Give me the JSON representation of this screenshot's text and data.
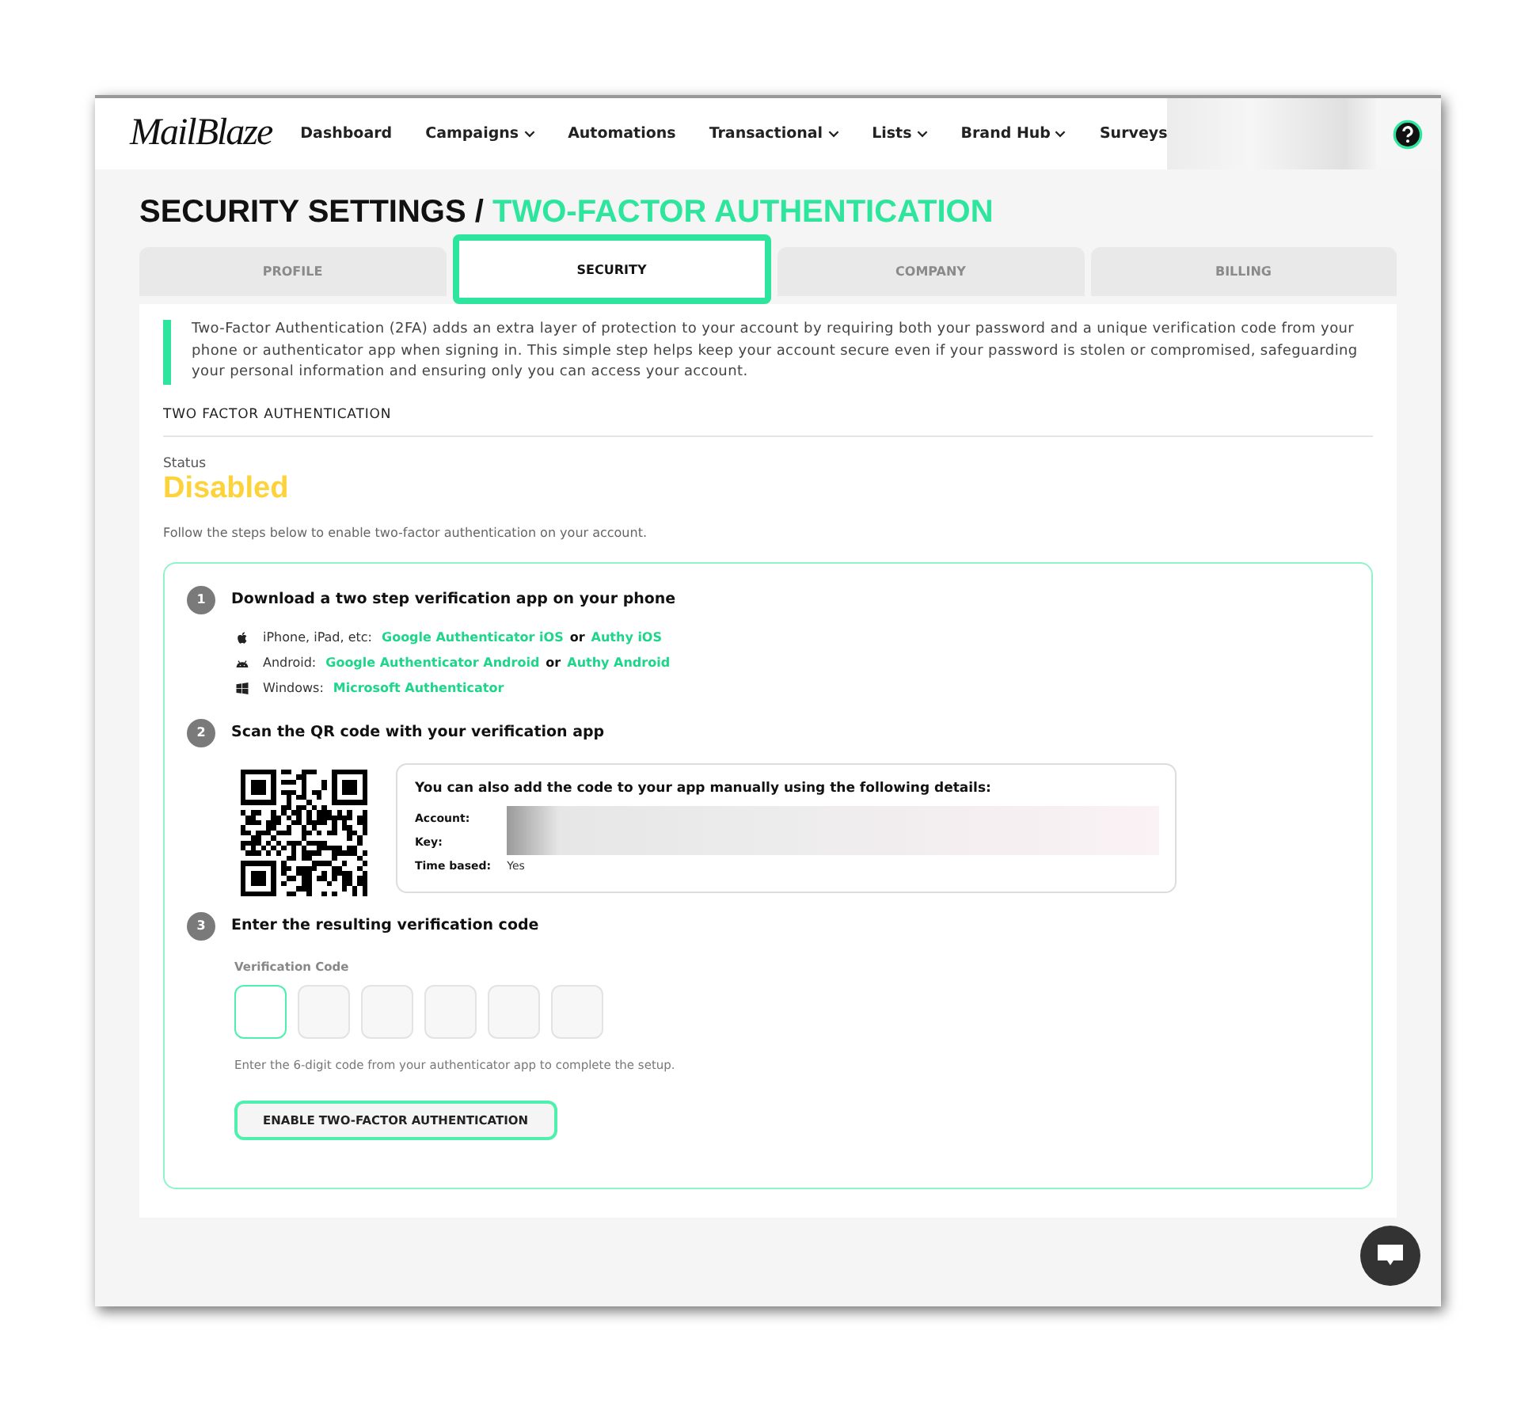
{
  "nav": {
    "logo": "MailBlaze",
    "items": [
      {
        "label": "Dashboard",
        "has_menu": false
      },
      {
        "label": "Campaigns",
        "has_menu": true
      },
      {
        "label": "Automations",
        "has_menu": false
      },
      {
        "label": "Transactional",
        "has_menu": true
      },
      {
        "label": "Lists",
        "has_menu": true
      },
      {
        "label": "Brand Hub",
        "has_menu": true
      },
      {
        "label": "Surveys",
        "has_menu": false
      }
    ]
  },
  "title": {
    "main": "SECURITY SETTINGS /",
    "accent": "TWO-FACTOR AUTHENTICATION"
  },
  "tabs": [
    {
      "label": "PROFILE",
      "selected": false
    },
    {
      "label": "SECURITY",
      "selected": true
    },
    {
      "label": "COMPANY",
      "selected": false
    },
    {
      "label": "BILLING",
      "selected": false
    }
  ],
  "intro": "Two-Factor Authentication (2FA) adds an extra layer of protection to your account by requiring both your password and a unique verification code from your phone or authenticator app when signing in. This simple step helps keep your account secure even if your password is stolen or compromised, safeguarding your personal information and ensuring only you can access your account.",
  "section_heading": "TWO FACTOR AUTHENTICATION",
  "status": {
    "label": "Status",
    "value": "Disabled"
  },
  "hint": "Follow the steps below to enable two-factor authentication on your account.",
  "steps": [
    {
      "number": "1",
      "title": "Download a two step verification app on your phone",
      "kind": "apps",
      "platforms": [
        {
          "kind": "apple",
          "label": "iPhone, iPad, etc:",
          "parts": [
            {
              "kind": "link",
              "text": "Google Authenticator iOS"
            },
            {
              "kind": "plain",
              "text": "or"
            },
            {
              "kind": "link",
              "text": "Authy iOS"
            }
          ]
        },
        {
          "kind": "android",
          "label": "Android:",
          "parts": [
            {
              "kind": "link",
              "text": "Google Authenticator Android"
            },
            {
              "kind": "plain",
              "text": "or"
            },
            {
              "kind": "link",
              "text": "Authy Android"
            }
          ]
        },
        {
          "kind": "windows",
          "label": "Windows:",
          "parts": [
            {
              "kind": "link",
              "text": "Microsoft Authenticator"
            }
          ]
        }
      ]
    },
    {
      "number": "2",
      "title": "Scan the QR code with your verification app",
      "kind": "qr",
      "manual": {
        "heading": "You can also add the code to your app manually using the following details:",
        "rows": [
          {
            "label": "Account:"
          },
          {
            "label": "Key:"
          },
          {
            "label": "Time based:",
            "value": "Yes"
          }
        ]
      }
    },
    {
      "number": "3",
      "title": "Enter the resulting verification code",
      "kind": "code",
      "field_label": "Verification Code",
      "digits": [
        {
          "focused": true
        },
        {
          "focused": false
        },
        {
          "focused": false
        },
        {
          "focused": false
        },
        {
          "focused": false
        },
        {
          "focused": false
        }
      ],
      "help": "Enter the 6-digit code from your authenticator app to complete the setup.",
      "button": "ENABLE TWO-FACTOR AUTHENTICATION"
    }
  ]
}
